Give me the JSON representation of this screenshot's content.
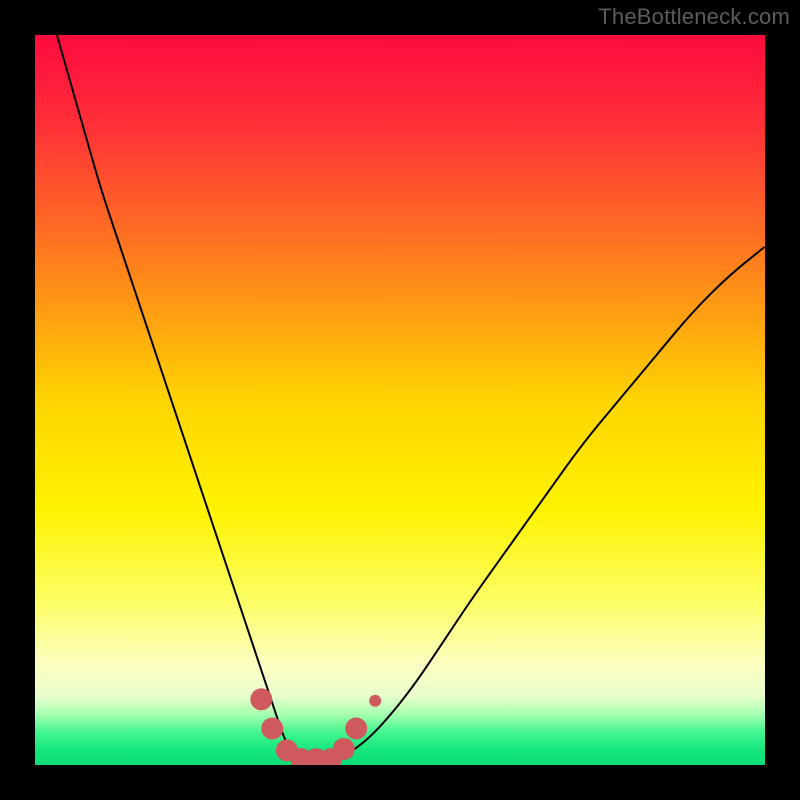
{
  "watermark": "TheBottleneck.com",
  "chart_data": {
    "type": "line",
    "title": "",
    "xlabel": "",
    "ylabel": "",
    "xlim": [
      0,
      100
    ],
    "ylim": [
      0,
      100
    ],
    "background_gradient": {
      "stops": [
        {
          "offset": 0.0,
          "color": "#ff0b3e"
        },
        {
          "offset": 0.12,
          "color": "#ff2f38"
        },
        {
          "offset": 0.3,
          "color": "#ff7a1f"
        },
        {
          "offset": 0.5,
          "color": "#ffd400"
        },
        {
          "offset": 0.65,
          "color": "#fff300"
        },
        {
          "offset": 0.78,
          "color": "#fcff68"
        },
        {
          "offset": 0.86,
          "color": "#fdffc0"
        },
        {
          "offset": 0.905,
          "color": "#eaffcc"
        },
        {
          "offset": 0.93,
          "color": "#a8ffb0"
        },
        {
          "offset": 0.955,
          "color": "#43f58e"
        },
        {
          "offset": 0.98,
          "color": "#14e77e"
        },
        {
          "offset": 1.0,
          "color": "#0fdc78"
        }
      ]
    },
    "series": [
      {
        "name": "bottleneck-curve",
        "stroke": "#000000",
        "stroke_width": 2,
        "x": [
          3,
          5,
          7,
          9,
          11,
          13,
          15,
          17,
          19,
          21,
          23,
          25,
          27,
          28,
          29,
          30,
          31,
          32,
          33,
          34,
          35,
          36,
          37,
          38,
          40,
          42,
          45,
          48,
          52,
          56,
          60,
          65,
          70,
          75,
          80,
          85,
          90,
          95,
          100
        ],
        "y": [
          100,
          93,
          86,
          79,
          73,
          67,
          61,
          55,
          49,
          43,
          37,
          31,
          25,
          22,
          19,
          16,
          13,
          10,
          7,
          4,
          2,
          1,
          0.3,
          0.3,
          0.3,
          1,
          3,
          6,
          11,
          17,
          23,
          30,
          37,
          44,
          50,
          56,
          62,
          67,
          71
        ]
      }
    ],
    "markers": {
      "color": "#cf5a5e",
      "radius_large": 11,
      "radius_small": 6,
      "points": [
        {
          "x": 31.0,
          "y": 9.0,
          "r": "large"
        },
        {
          "x": 32.5,
          "y": 5.0,
          "r": "large"
        },
        {
          "x": 34.5,
          "y": 2.0,
          "r": "large"
        },
        {
          "x": 36.5,
          "y": 0.8,
          "r": "large"
        },
        {
          "x": 38.5,
          "y": 0.8,
          "r": "large"
        },
        {
          "x": 40.5,
          "y": 0.8,
          "r": "large"
        },
        {
          "x": 42.3,
          "y": 2.2,
          "r": "large"
        },
        {
          "x": 44.0,
          "y": 5.0,
          "r": "large"
        },
        {
          "x": 46.6,
          "y": 8.8,
          "r": "small"
        }
      ]
    }
  }
}
